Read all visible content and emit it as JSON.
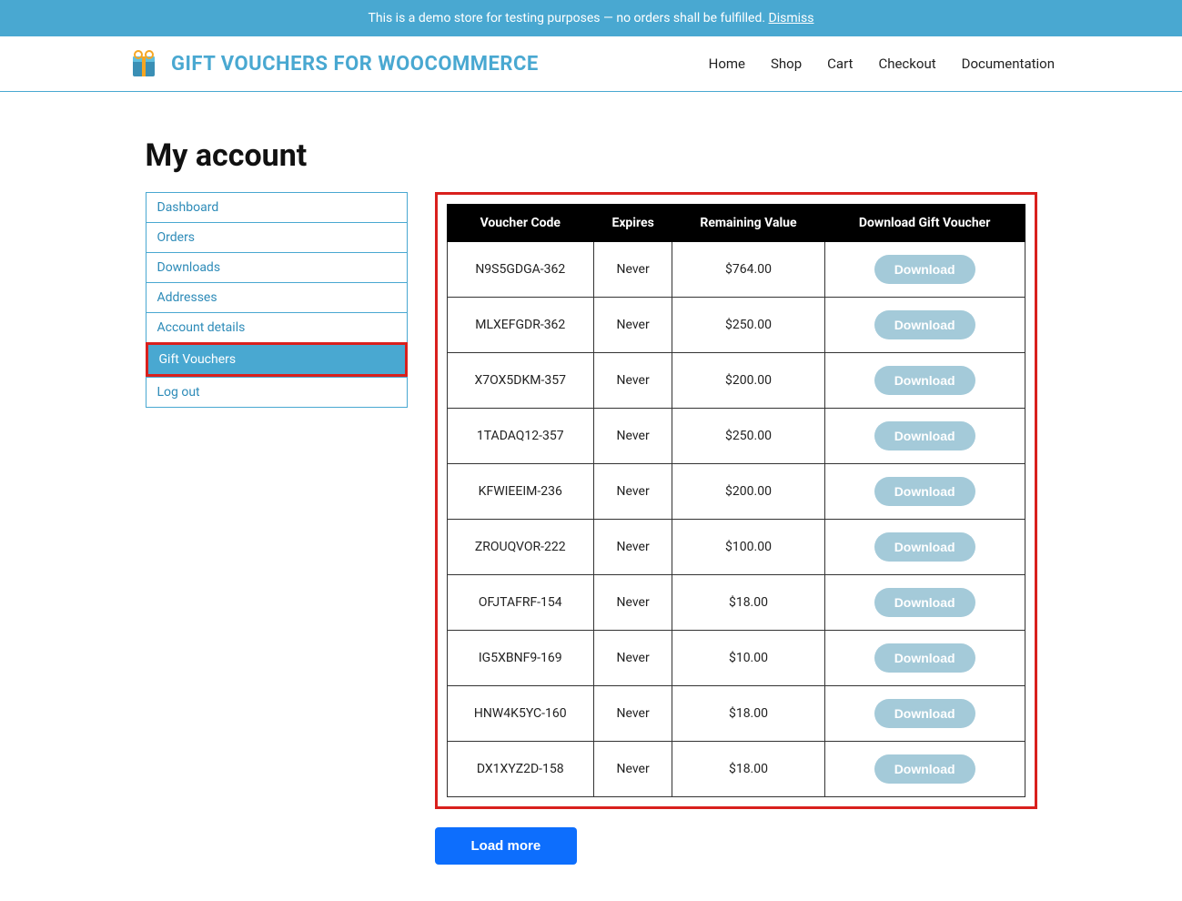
{
  "banner": {
    "text": "This is a demo store for testing purposes — no orders shall be fulfilled. ",
    "dismiss": "Dismiss"
  },
  "brand": {
    "title": "GIFT VOUCHERS FOR WOOCOMMERCE"
  },
  "nav": {
    "items": [
      "Home",
      "Shop",
      "Cart",
      "Checkout",
      "Documentation"
    ]
  },
  "page": {
    "title": "My account"
  },
  "sidebar": {
    "items": [
      {
        "label": "Dashboard",
        "active": false
      },
      {
        "label": "Orders",
        "active": false
      },
      {
        "label": "Downloads",
        "active": false
      },
      {
        "label": "Addresses",
        "active": false
      },
      {
        "label": "Account details",
        "active": false
      },
      {
        "label": "Gift Vouchers",
        "active": true
      },
      {
        "label": "Log out",
        "active": false
      }
    ]
  },
  "table": {
    "headers": [
      "Voucher Code",
      "Expires",
      "Remaining Value",
      "Download Gift Voucher"
    ],
    "download_label": "Download",
    "rows": [
      {
        "code": "N9S5GDGA-362",
        "expires": "Never",
        "value": "$764.00"
      },
      {
        "code": "MLXEFGDR-362",
        "expires": "Never",
        "value": "$250.00"
      },
      {
        "code": "X7OX5DKM-357",
        "expires": "Never",
        "value": "$200.00"
      },
      {
        "code": "1TADAQ12-357",
        "expires": "Never",
        "value": "$250.00"
      },
      {
        "code": "KFWIEEIM-236",
        "expires": "Never",
        "value": "$200.00"
      },
      {
        "code": "ZROUQVOR-222",
        "expires": "Never",
        "value": "$100.00"
      },
      {
        "code": "OFJTAFRF-154",
        "expires": "Never",
        "value": "$18.00"
      },
      {
        "code": "IG5XBNF9-169",
        "expires": "Never",
        "value": "$10.00"
      },
      {
        "code": "HNW4K5YC-160",
        "expires": "Never",
        "value": "$18.00"
      },
      {
        "code": "DX1XYZ2D-158",
        "expires": "Never",
        "value": "$18.00"
      }
    ]
  },
  "load_more": "Load more"
}
